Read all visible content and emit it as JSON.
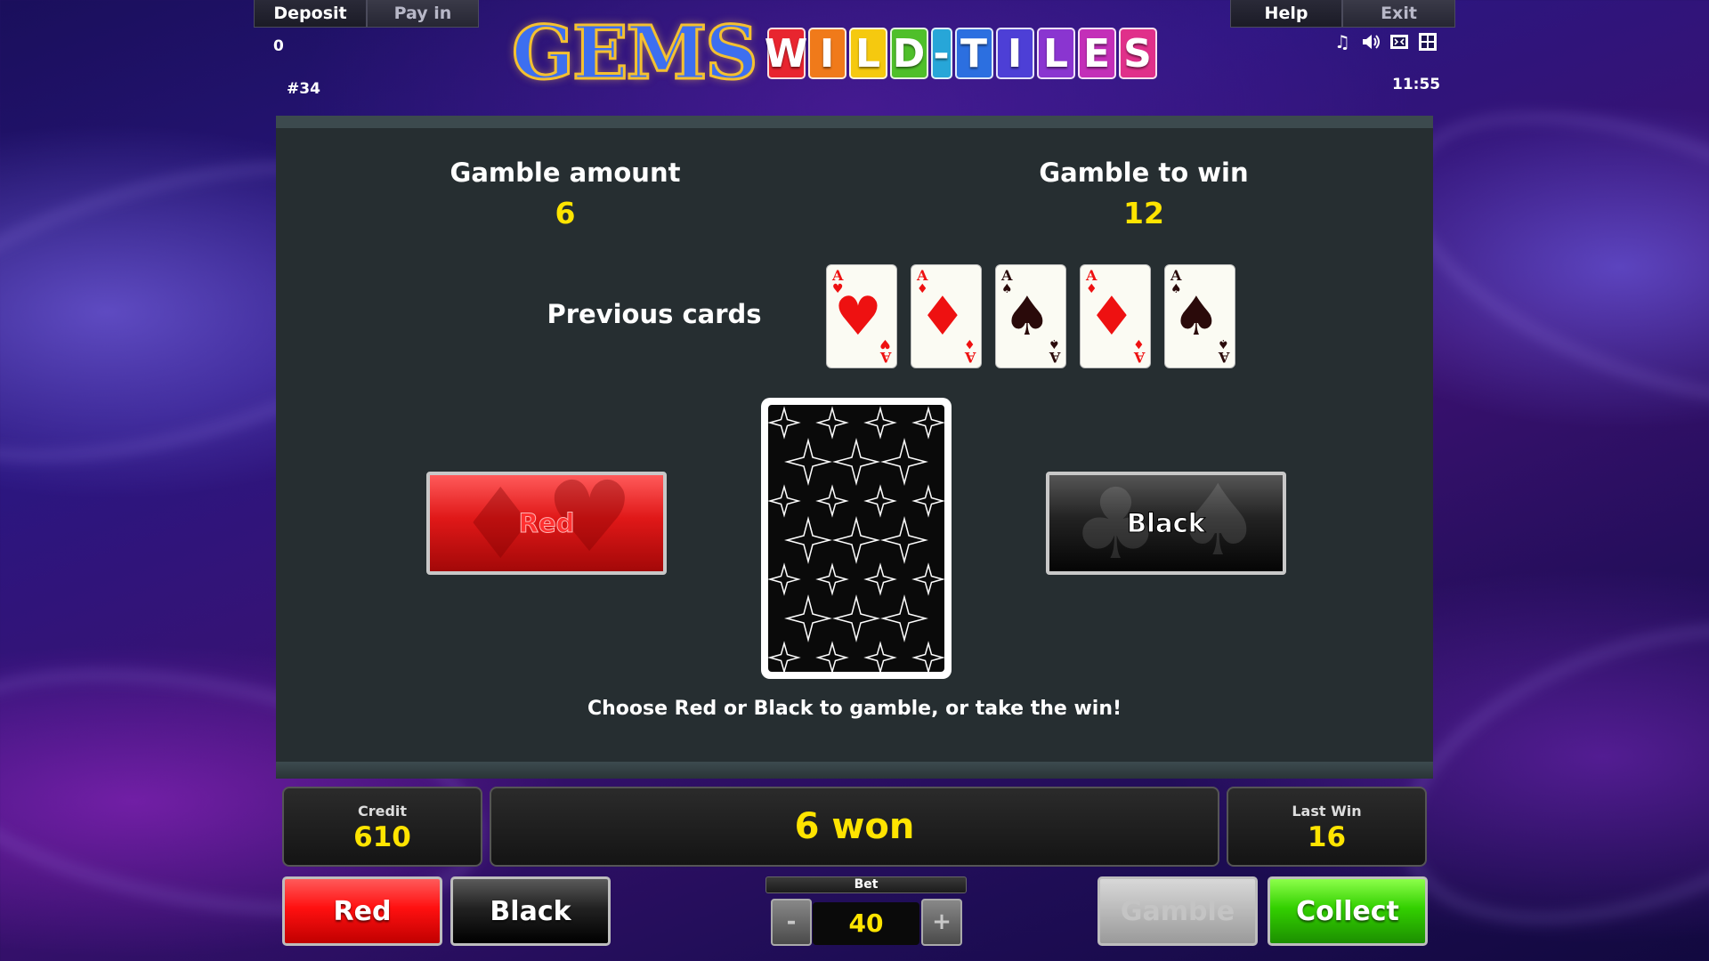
{
  "topbar": {
    "deposit_label": "Deposit",
    "pay_in_label": "Pay in",
    "help_label": "Help",
    "exit_label": "Exit",
    "balance": "0",
    "game_number": "#34",
    "clock": "11:55"
  },
  "logo": {
    "word1": "GEMS",
    "tiles": [
      "W",
      "I",
      "L",
      "D",
      "-",
      "T",
      "I",
      "L",
      "E",
      "S"
    ],
    "tile_colors": [
      "#e8252f",
      "#f07a1a",
      "#f5c90f",
      "#4fbf2a",
      "#27a6d8",
      "#2c6fe0",
      "#4d3fd6",
      "#8a35d0",
      "#c32fb8",
      "#e0308a"
    ]
  },
  "hud_icons": [
    "music-note-icon",
    "speaker-icon",
    "screen-icon",
    "grid-icon"
  ],
  "gamble": {
    "amount_label": "Gamble amount",
    "amount_value": "6",
    "to_win_label": "Gamble to win",
    "to_win_value": "12",
    "previous_label": "Previous cards",
    "previous_cards": [
      {
        "rank": "A",
        "suit": "♥",
        "color": "red"
      },
      {
        "rank": "A",
        "suit": "♦",
        "color": "red"
      },
      {
        "rank": "A",
        "suit": "♠",
        "color": "black"
      },
      {
        "rank": "A",
        "suit": "♦",
        "color": "red"
      },
      {
        "rank": "A",
        "suit": "♠",
        "color": "black"
      }
    ],
    "red_choice_label": "Red",
    "black_choice_label": "Black",
    "hint": "Choose Red or Black to gamble, or take the win!"
  },
  "status": {
    "credit_label": "Credit",
    "credit_value": "610",
    "message": "6 won",
    "last_win_label": "Last Win",
    "last_win_value": "16"
  },
  "controls": {
    "red_label": "Red",
    "black_label": "Black",
    "bet_label": "Bet",
    "bet_value": "40",
    "bet_minus": "-",
    "bet_plus": "+",
    "gamble_label": "Gamble",
    "collect_label": "Collect"
  },
  "colors": {
    "accent_yellow": "#ffe400",
    "panel_bg": "#262e31",
    "red_button": "#ff1010",
    "collect_green": "#33d000"
  }
}
